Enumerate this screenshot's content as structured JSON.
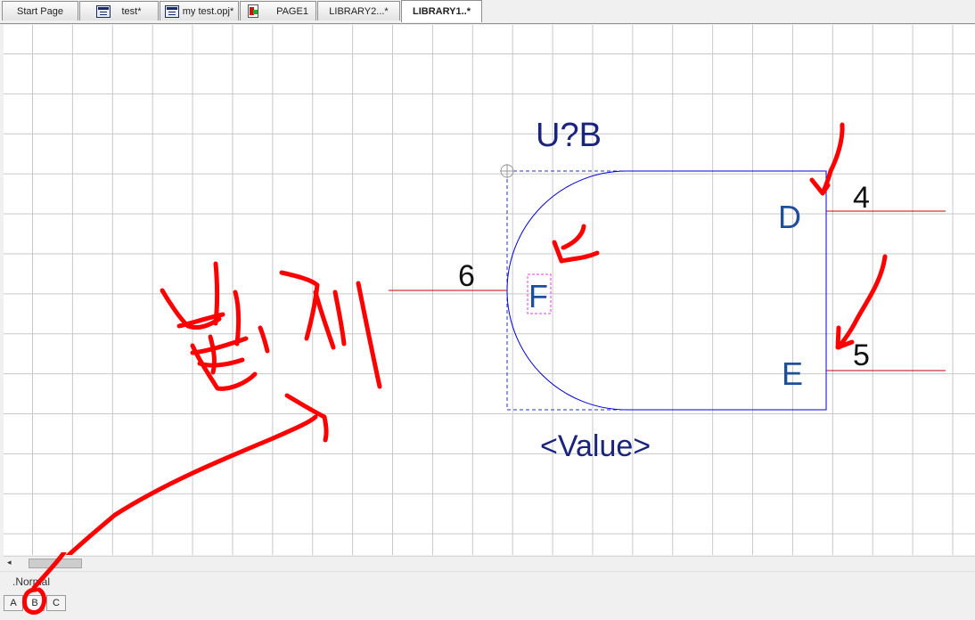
{
  "tabs": [
    {
      "label": "Start Page",
      "icon": "none",
      "active": false
    },
    {
      "label": "test*",
      "icon": "schematic-icon",
      "active": false
    },
    {
      "label": "my test.opj*",
      "icon": "schematic-icon",
      "active": false
    },
    {
      "label": "PAGE1",
      "icon": "page-icon",
      "active": false
    },
    {
      "label": "LIBRARY2...*",
      "icon": "none",
      "active": false
    },
    {
      "label": "LIBRARY1..*",
      "icon": "none",
      "active": true
    }
  ],
  "part": {
    "reference": "U?B",
    "value": "<Value>",
    "pin_names": [
      "D",
      "F",
      "E"
    ],
    "pin_numbers": [
      "4",
      "6",
      "5"
    ]
  },
  "annotation": {
    "handwritten_text": "볼게"
  },
  "status": {
    "text": ".Normal"
  },
  "page_tabs": [
    "A",
    "B",
    "C"
  ],
  "colors": {
    "grid": "#c8c8c8",
    "body_outline": "#0000e6",
    "pin_line": "#cc0000",
    "pin_name": "#1f4e9a",
    "reference": "#1a237e",
    "annotation": "#ff0000"
  }
}
